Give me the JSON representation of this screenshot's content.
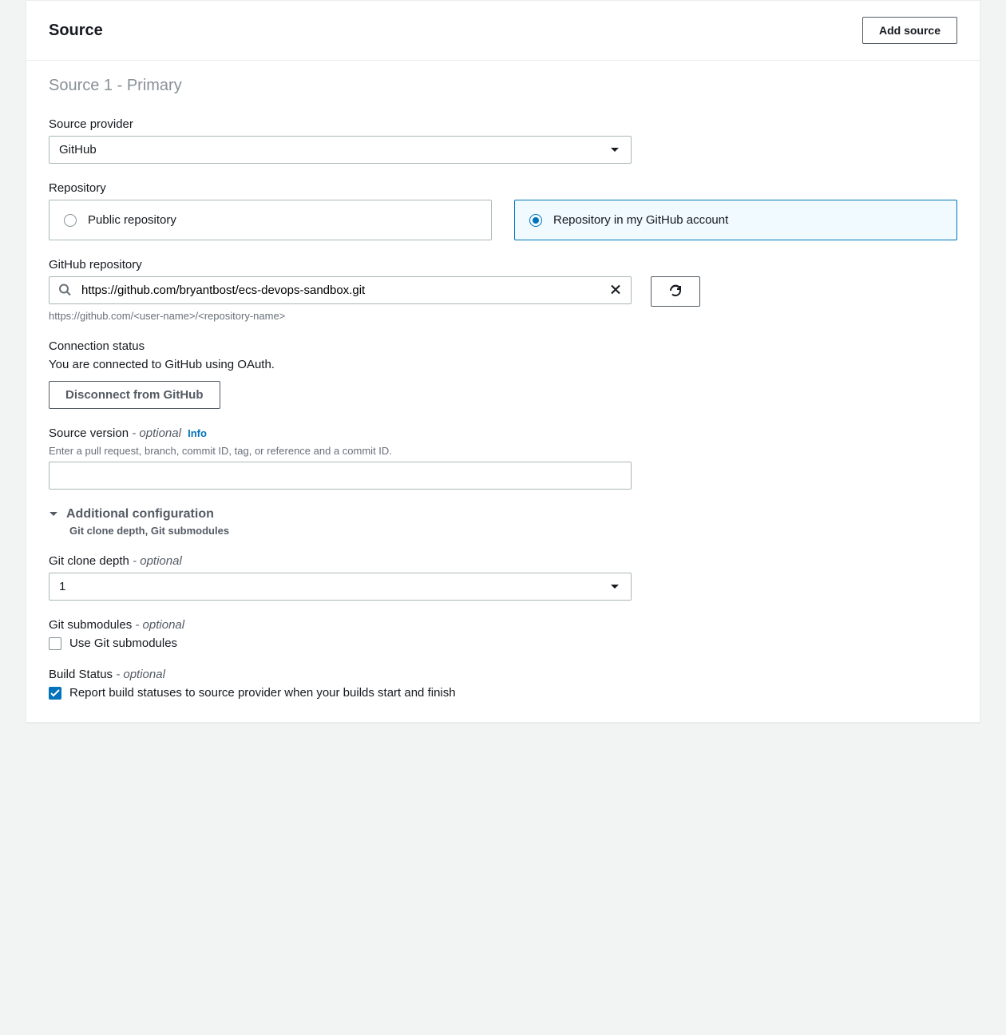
{
  "panel": {
    "title": "Source",
    "add_source_label": "Add source"
  },
  "source": {
    "subtitle": "Source 1 - Primary",
    "provider_label": "Source provider",
    "provider_value": "GitHub",
    "repository_label": "Repository",
    "repo_option_public": "Public repository",
    "repo_option_mine": "Repository in my GitHub account",
    "repo_selected": "mine",
    "github_repo_label": "GitHub repository",
    "github_repo_value": "https://github.com/bryantbost/ecs-devops-sandbox.git",
    "github_repo_hint": "https://github.com/<user-name>/<repository-name>",
    "connection_status_label": "Connection status",
    "connection_status_text": "You are connected to GitHub using OAuth.",
    "disconnect_label": "Disconnect from GitHub",
    "source_version_label": "Source version",
    "source_version_optional": " - optional",
    "info_label": "Info",
    "source_version_hint": "Enter a pull request, branch, commit ID, tag, or reference and a commit ID.",
    "source_version_value": "",
    "additional_config_label": "Additional configuration",
    "additional_config_sub": "Git clone depth, Git submodules",
    "clone_depth_label": "Git clone depth",
    "clone_depth_optional": " - optional",
    "clone_depth_value": "1",
    "submodules_label": "Git submodules",
    "submodules_optional": " - optional",
    "submodules_checkbox_label": "Use Git submodules",
    "submodules_checked": false,
    "build_status_label": "Build Status",
    "build_status_optional": " - optional",
    "build_status_checkbox_label": "Report build statuses to source provider when your builds start and finish",
    "build_status_checked": true
  }
}
